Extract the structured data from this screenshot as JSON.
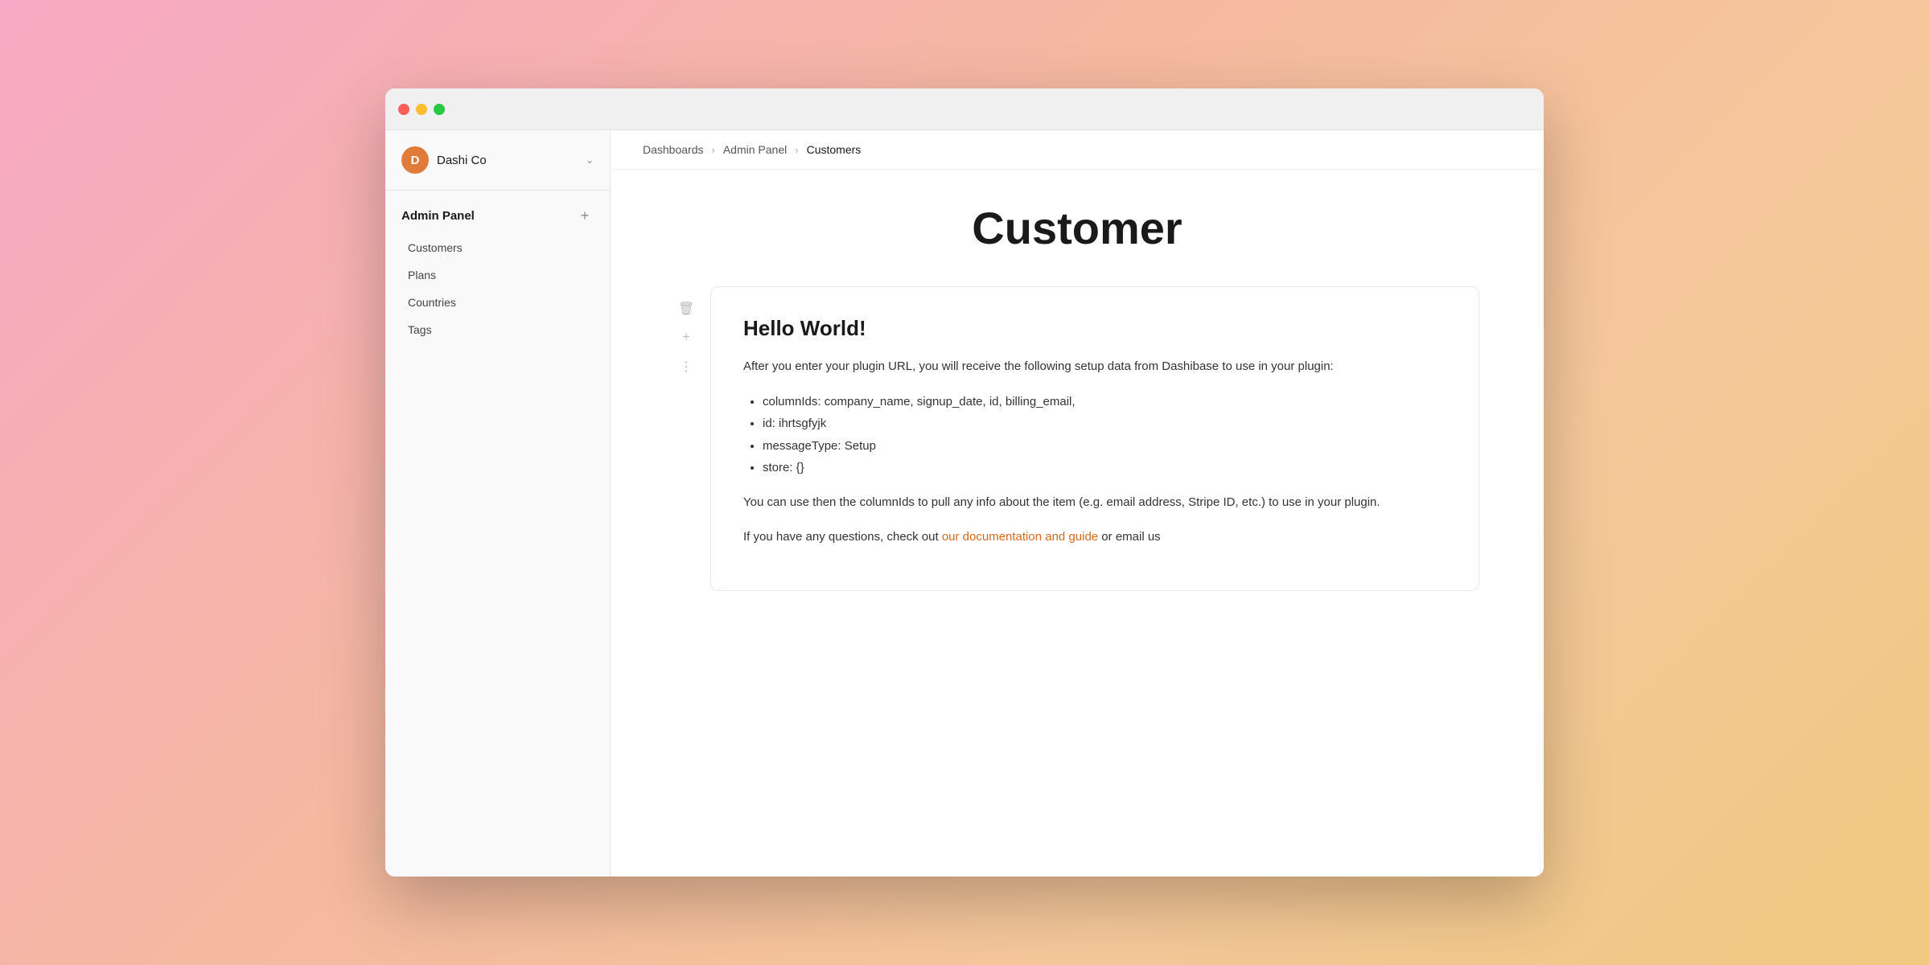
{
  "window": {
    "titlebar": {
      "lights": [
        "red",
        "yellow",
        "green"
      ]
    }
  },
  "sidebar": {
    "workspace": {
      "avatar_letter": "D",
      "name": "Dashi Co",
      "avatar_color": "#e07b3a"
    },
    "section_title": "Admin Panel",
    "add_button_label": "+",
    "nav_items": [
      {
        "label": "Customers",
        "id": "customers"
      },
      {
        "label": "Plans",
        "id": "plans"
      },
      {
        "label": "Countries",
        "id": "countries"
      },
      {
        "label": "Tags",
        "id": "tags"
      }
    ]
  },
  "breadcrumb": {
    "items": [
      {
        "label": "Dashboards",
        "active": false
      },
      {
        "label": "Admin Panel",
        "active": false
      },
      {
        "label": "Customers",
        "active": true
      }
    ]
  },
  "page": {
    "title": "Customer",
    "card": {
      "heading": "Hello World!",
      "paragraph1": "After you enter your plugin URL, you will receive the following setup data from Dashibase to use in your plugin:",
      "list_items": [
        "columnIds: company_name, signup_date, id, billing_email,",
        "id: ihrtsgfyjk",
        "messageType: Setup",
        "store: {}"
      ],
      "paragraph2": "You can use then the columnIds to pull any info about the item (e.g. email address, Stripe ID, etc.) to use in your plugin.",
      "paragraph3_prefix": "If you have any questions, check out ",
      "paragraph3_link": "our documentation and guide",
      "paragraph3_suffix": " or email us"
    }
  },
  "icons": {
    "trash": "🗑",
    "plus": "+",
    "dots": "⋮",
    "chevron_right": "›",
    "chevron_down": "⌄"
  }
}
